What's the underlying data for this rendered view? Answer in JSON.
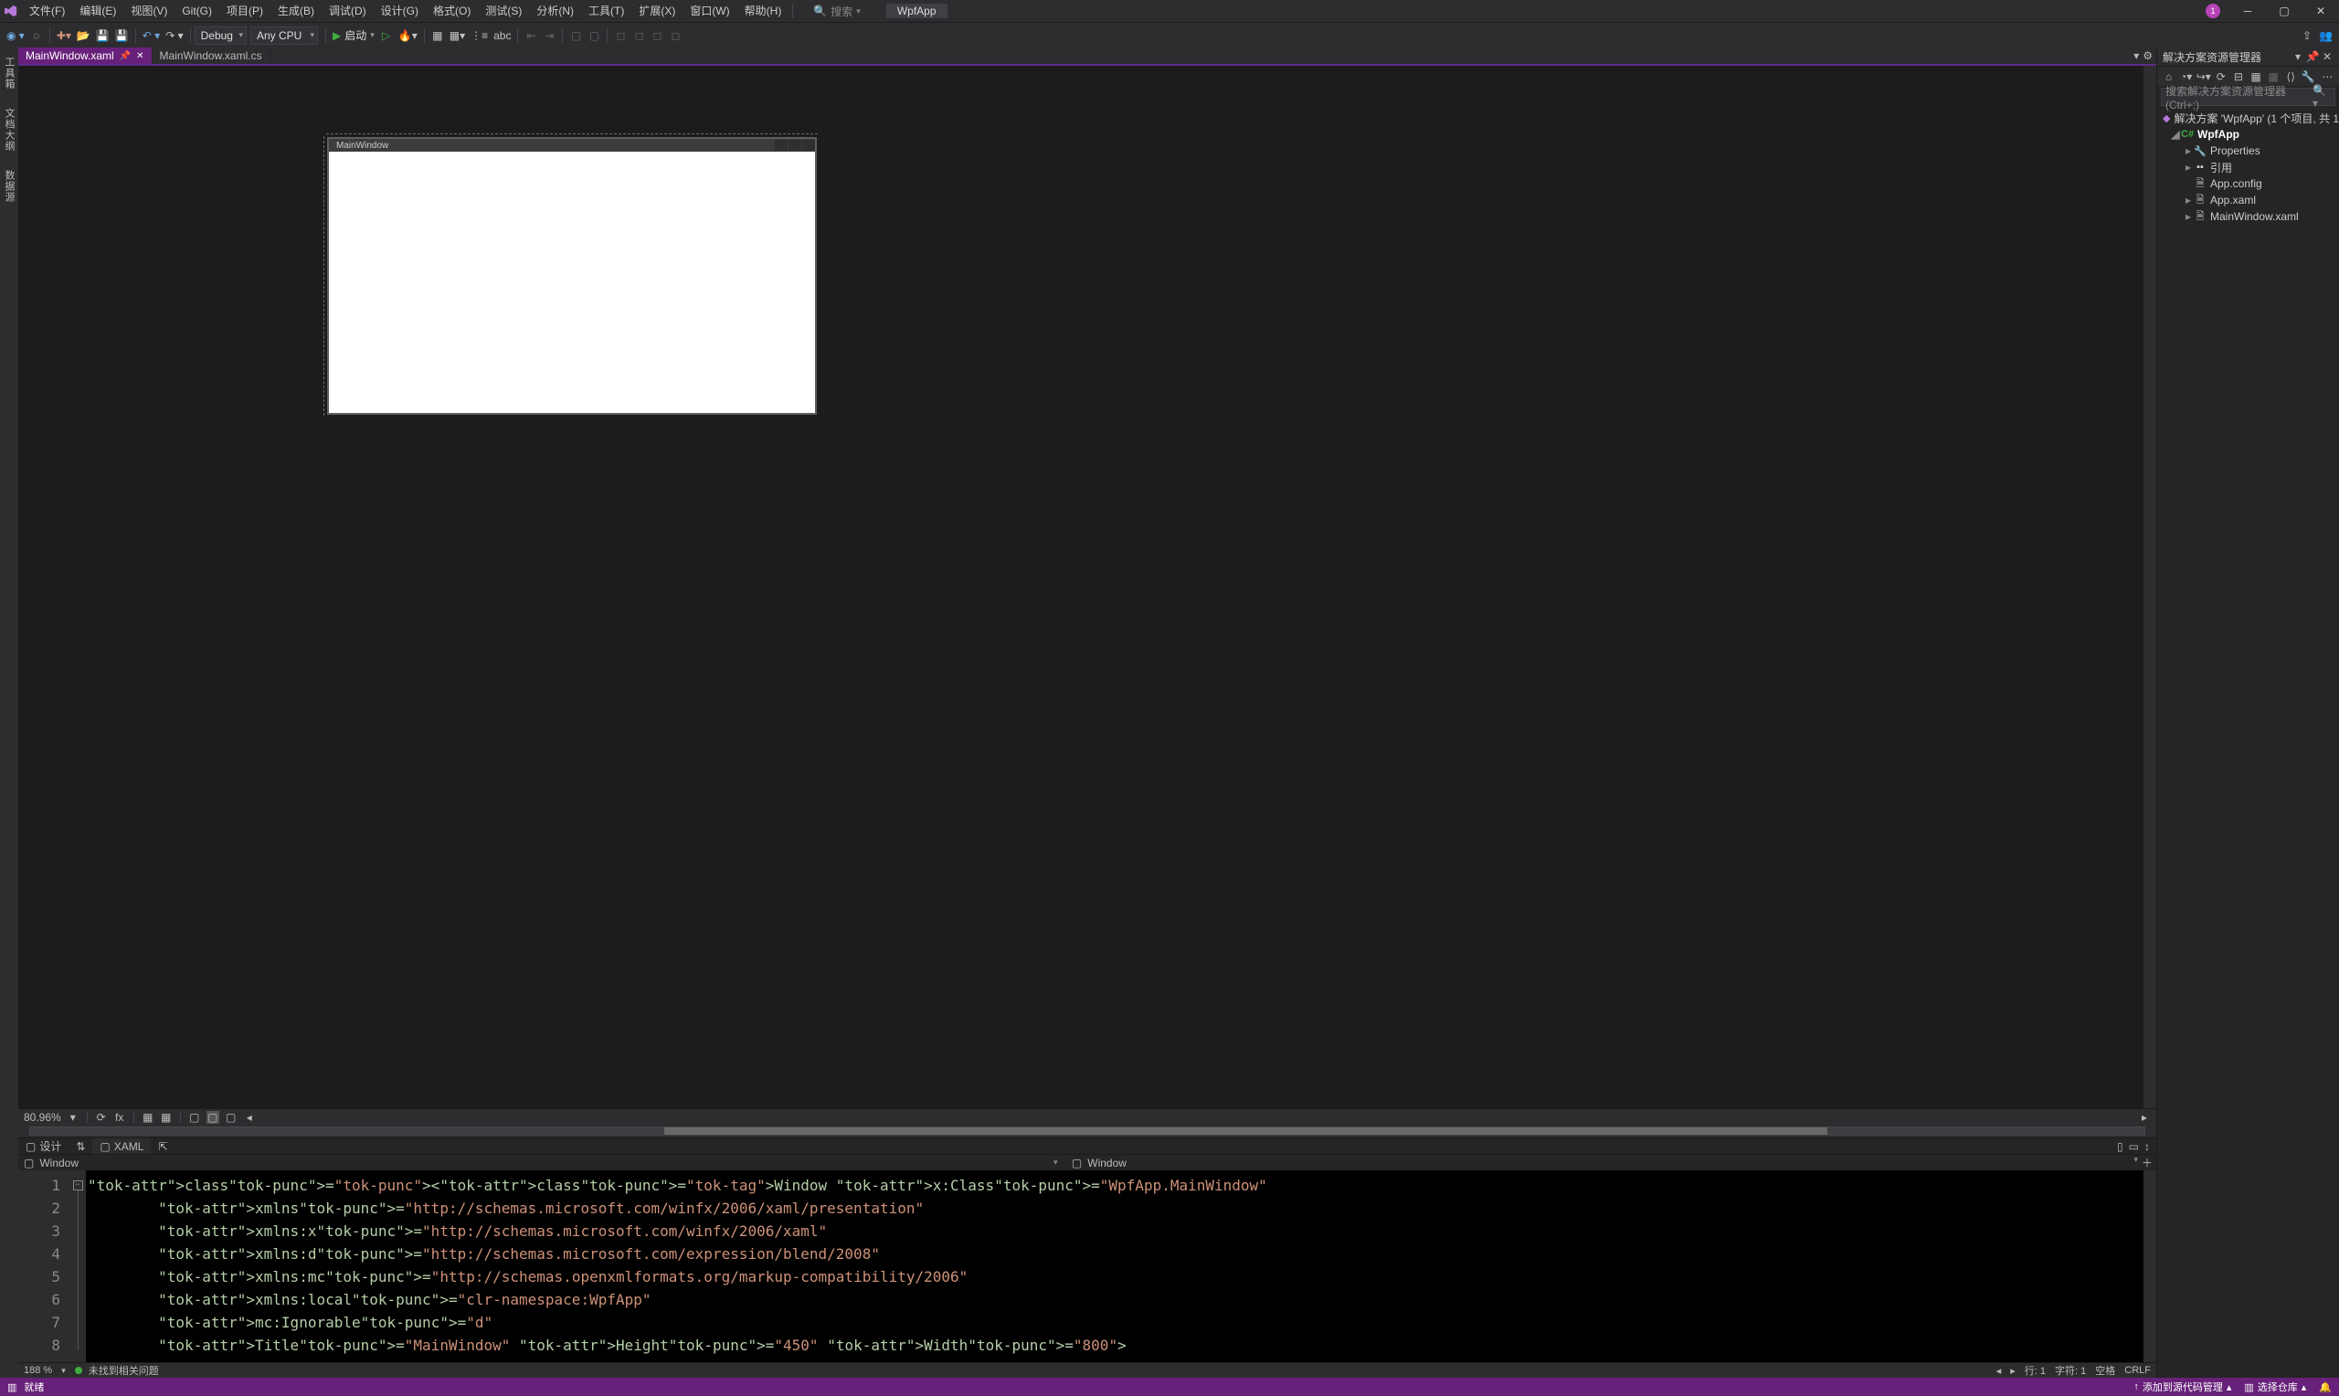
{
  "menu": {
    "file": "文件(F)",
    "edit": "编辑(E)",
    "view": "视图(V)",
    "git": "Git(G)",
    "project": "项目(P)",
    "build": "生成(B)",
    "debug": "调试(D)",
    "design": "设计(G)",
    "format": "格式(O)",
    "test": "测试(S)",
    "analyze": "分析(N)",
    "tools": "工具(T)",
    "extensions": "扩展(X)",
    "window": "窗口(W)",
    "help": "帮助(H)"
  },
  "titlebar": {
    "search": "搜索",
    "app_name": "WpfApp",
    "notif_count": "1"
  },
  "toolbar": {
    "config": "Debug",
    "platform": "Any CPU",
    "start": "启动"
  },
  "doctabs": {
    "active": "MainWindow.xaml",
    "inactive": "MainWindow.xaml.cs"
  },
  "sidetabs": {
    "toolbox": "工具箱",
    "docoutline": "文档大纲",
    "datasource": "数据源"
  },
  "designer": {
    "window_title": "MainWindow",
    "zoom": "80.96%"
  },
  "viewswitch": {
    "design": "设计",
    "xaml": "XAML",
    "swap": "⇅",
    "popout": "⇱"
  },
  "codenav": {
    "left_icon": "▢",
    "left": "Window",
    "right_icon": "▢",
    "right": "Window"
  },
  "code": {
    "lines": [
      {
        "n": "1",
        "t": "<Window x:Class=\"WpfApp.MainWindow\""
      },
      {
        "n": "2",
        "t": "        xmlns=\"http://schemas.microsoft.com/winfx/2006/xaml/presentation\""
      },
      {
        "n": "3",
        "t": "        xmlns:x=\"http://schemas.microsoft.com/winfx/2006/xaml\""
      },
      {
        "n": "4",
        "t": "        xmlns:d=\"http://schemas.microsoft.com/expression/blend/2008\""
      },
      {
        "n": "5",
        "t": "        xmlns:mc=\"http://schemas.openxmlformats.org/markup-compatibility/2006\""
      },
      {
        "n": "6",
        "t": "        xmlns:local=\"clr-namespace:WpfApp\""
      },
      {
        "n": "7",
        "t": "        mc:Ignorable=\"d\""
      },
      {
        "n": "8",
        "t": "        Title=\"MainWindow\" Height=\"450\" Width=\"800\">"
      }
    ]
  },
  "editor_status": {
    "zoom": "188 %",
    "issues": "未找到相关问题",
    "line_lbl": "行:",
    "line": "1",
    "col_lbl": "字符:",
    "col": "1",
    "spaces": "空格",
    "eol": "CRLF"
  },
  "solexp": {
    "title": "解决方案资源管理器",
    "search_placeholder": "搜索解决方案资源管理器(Ctrl+;)",
    "solution": "解决方案 'WpfApp' (1 个项目, 共 1",
    "project": "WpfApp",
    "items": {
      "properties": "Properties",
      "refs": "引用",
      "appconfig": "App.config",
      "appxaml": "App.xaml",
      "mainwin": "MainWindow.xaml"
    }
  },
  "statusbar": {
    "ready": "就绪",
    "add_src": "添加到源代码管理",
    "select_repo": "选择仓库"
  }
}
